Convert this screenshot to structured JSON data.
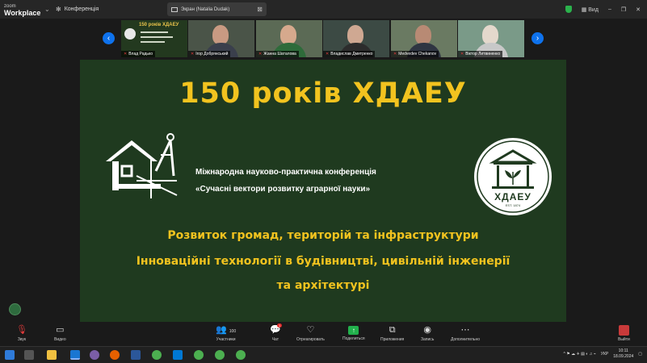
{
  "app": {
    "logo_small": "zoom",
    "logo_big": "Workplace",
    "meeting_name": "Конференція",
    "share_label": "Экран (Natalia Dudak)",
    "view_label": "Вид"
  },
  "participants": [
    {
      "name": "Влад Радько",
      "type": "slide",
      "thumb_title": "150 років ХДАЕУ"
    },
    {
      "name": "Ігор Добрянський",
      "type": "person"
    },
    {
      "name": "Жанна Шаталова",
      "type": "person"
    },
    {
      "name": "Владислав Дмитренко",
      "type": "person"
    },
    {
      "name": "Medvedev Chekanov",
      "type": "person"
    },
    {
      "name": "Віктор Литвиненко",
      "type": "person"
    }
  ],
  "slide": {
    "title": "150 років ХДАЕУ",
    "line1": "Міжнародна науково-практична конференція",
    "line2": "«Сучасні вектори розвитку аграрної науки»",
    "topic1": "Розвиток громад, територій та інфраструктури",
    "topic2": "Інноваційні технології в будівництві, цивільній інженерії",
    "topic3": "та архітектурі",
    "emblem_text": "ХДАЕУ",
    "emblem_est": "EST. 1874"
  },
  "toolbar": {
    "audio": "Звук",
    "video": "Видео",
    "participants": "Участники",
    "participants_count": "100",
    "chat": "Чат",
    "chat_badge": "1",
    "react": "Отреагировать",
    "share": "Поделиться",
    "apps": "Приложения",
    "record": "Запись",
    "more": "Дополнительно",
    "leave": "Выйти"
  },
  "taskbar": {
    "lang": "УКР",
    "time": "10:11",
    "date": "18.09.2024"
  },
  "colors": {
    "slide_bg": "#1f3a1f",
    "accent_yellow": "#f2c31f",
    "zoom_blue": "#0e72ed",
    "share_green": "#22b14c"
  }
}
